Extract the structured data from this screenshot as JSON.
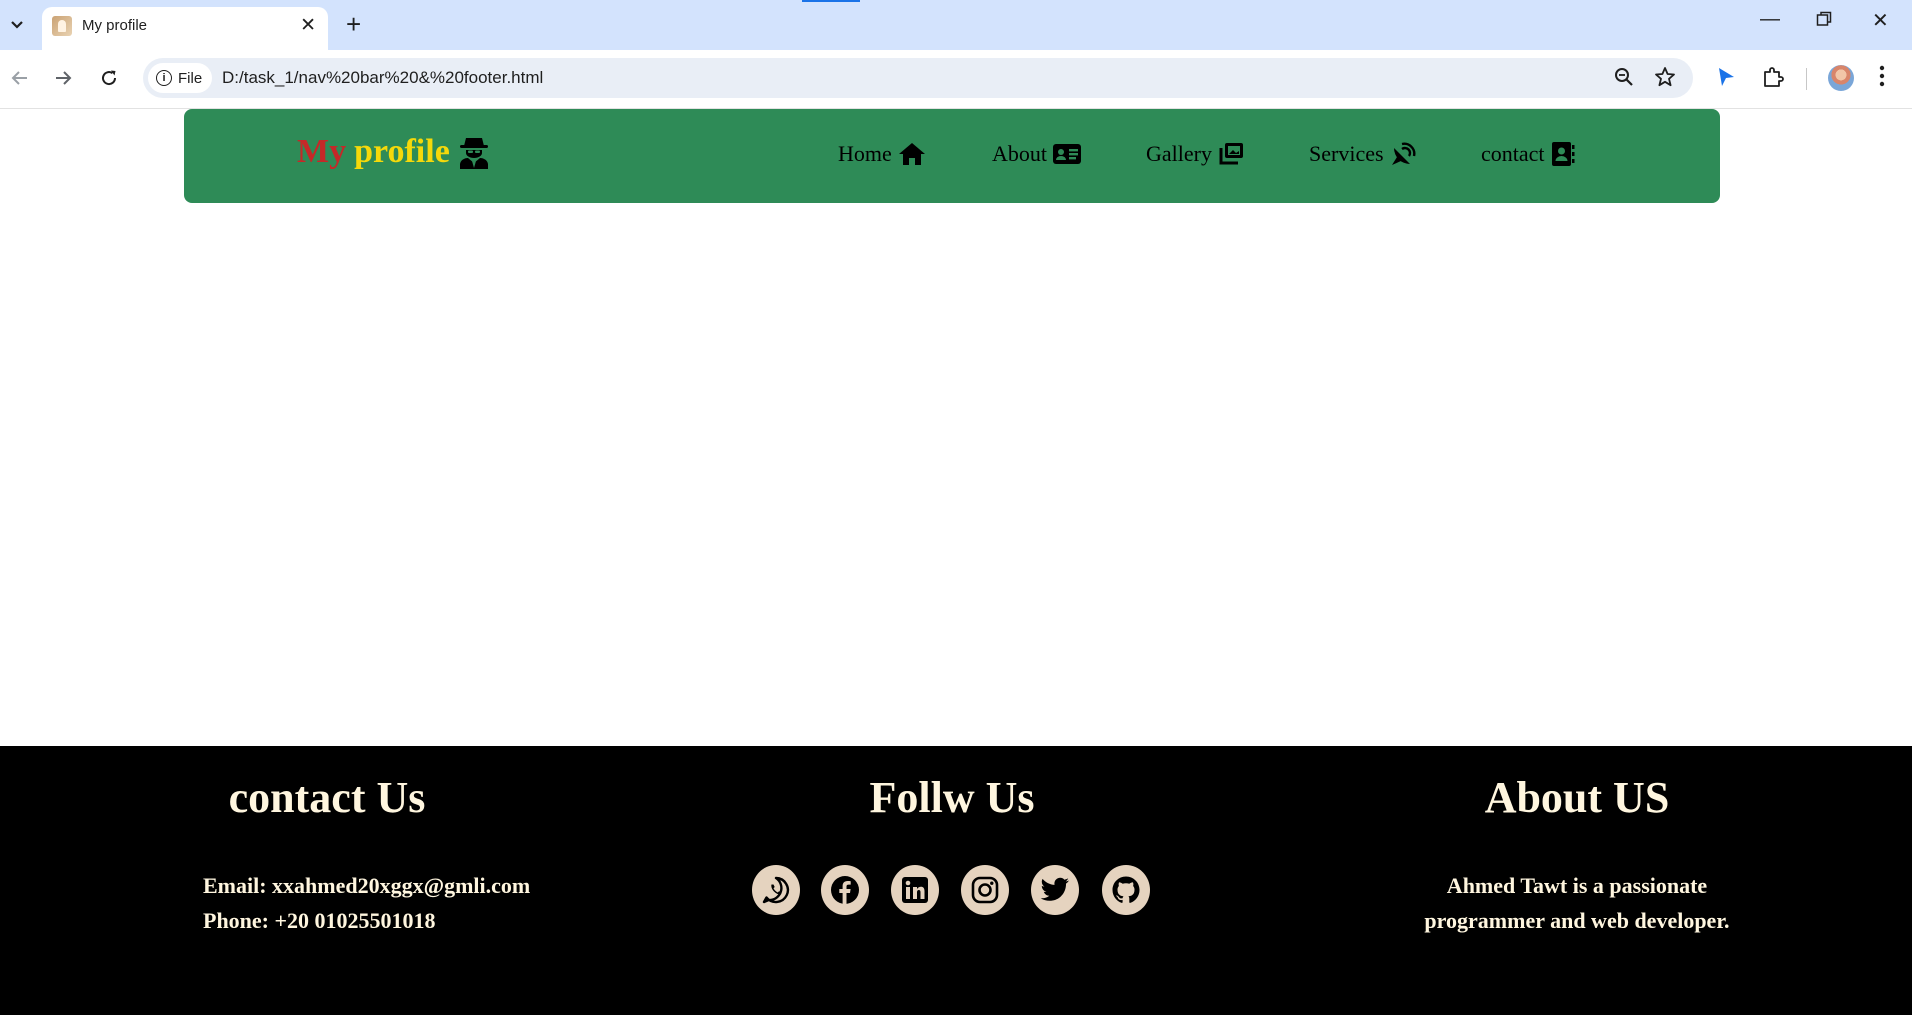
{
  "browser": {
    "tab_title": "My profile",
    "url": "D:/task_1/nav%20bar%20&%20footer.html",
    "scheme_chip": "File"
  },
  "navbar": {
    "brand_my": "My",
    "brand_profile": "profile",
    "brand_icon": "user-secret-icon",
    "links": [
      {
        "label": "Home",
        "icon": "home-icon"
      },
      {
        "label": "About",
        "icon": "id-card-icon"
      },
      {
        "label": "Gallery",
        "icon": "images-icon"
      },
      {
        "label": "Services",
        "icon": "satellite-dish-icon"
      },
      {
        "label": "contact",
        "icon": "address-book-icon"
      }
    ],
    "colors": {
      "background": "#2e8b57",
      "my": "#c62828",
      "profile": "#f5d90a"
    }
  },
  "footer": {
    "contact": {
      "heading": "contact Us",
      "email": "Email: xxahmed20xggx@gmli.com",
      "phone": "Phone: +20 01025501018"
    },
    "follow": {
      "heading": "Follw Us",
      "icons": [
        "whatsapp-icon",
        "facebook-icon",
        "linkedin-icon",
        "instagram-icon",
        "twitter-icon",
        "github-icon"
      ]
    },
    "about": {
      "heading": "About US",
      "line1": "Ahmed Tawt is a passionate",
      "line2": "programmer and web developer."
    },
    "colors": {
      "background": "#000000",
      "text": "#fff6df",
      "icon_circle": "#e5d3bf"
    }
  }
}
